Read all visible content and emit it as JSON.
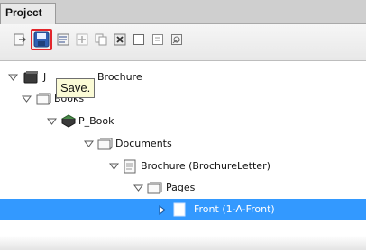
{
  "panel": {
    "tab_label": "Project"
  },
  "toolbar": {
    "buttons": [
      {
        "icon": "export-icon"
      },
      {
        "icon": "save-icon"
      },
      {
        "icon": "list-icon"
      },
      {
        "icon": "add-icon"
      },
      {
        "icon": "copy-icon"
      },
      {
        "icon": "delete-icon"
      },
      {
        "icon": "page-icon"
      },
      {
        "icon": "document-icon"
      },
      {
        "icon": "image-icon"
      }
    ]
  },
  "tooltip": {
    "text": "Save."
  },
  "tree": {
    "rows": [
      {
        "label": "J",
        "hidden_label": "Brochure",
        "icon": "book-stack-icon"
      },
      {
        "label": "Books",
        "icon": "folder-icon"
      },
      {
        "label": "P_Book",
        "icon": "book-icon"
      },
      {
        "label": "Documents",
        "icon": "folder-icon"
      },
      {
        "label": "Brochure (BrochureLetter)",
        "icon": "document-icon"
      },
      {
        "label": "Pages",
        "icon": "folder-icon"
      },
      {
        "label": "Front (1-A-Front)",
        "icon": "page-icon",
        "selected": true
      }
    ]
  },
  "colors": {
    "selection": "#3399ff",
    "highlight_border": "#e3262b",
    "tooltip_bg": "#fbfbd6"
  }
}
